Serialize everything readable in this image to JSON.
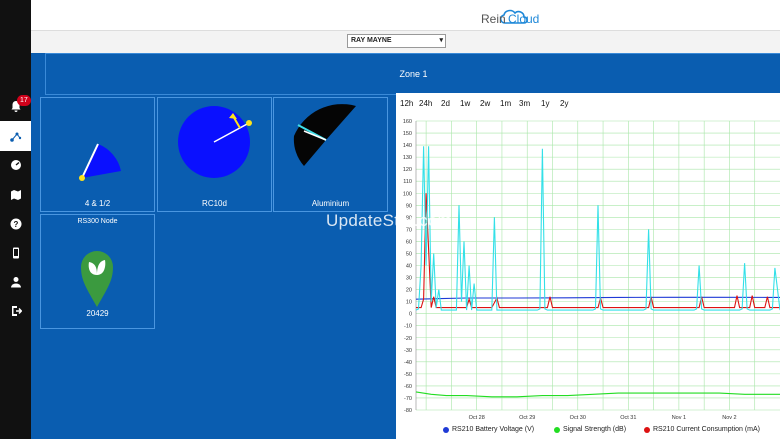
{
  "app": {
    "logo_text_a": "Rein",
    "logo_text_b": "Cloud"
  },
  "selector": {
    "selected": "RAY MAYNE"
  },
  "zone": {
    "title": "Zone 1"
  },
  "sidebar": {
    "notification_count": "17",
    "items": [
      "bell-icon",
      "sprinkler-icon",
      "gauge-icon",
      "map-icon",
      "help-icon",
      "phone-icon",
      "user-icon",
      "logout-icon"
    ]
  },
  "tiles": [
    {
      "label": "4 & 1/2"
    },
    {
      "label": "RC10d"
    },
    {
      "label": "Aluminium"
    },
    {
      "title": "RS300 Node",
      "label": "20429"
    }
  ],
  "watermark": "UpdateStar.com",
  "chart_panel": {
    "ranges": [
      "12h",
      "24h",
      "2d",
      "1w",
      "2w",
      "1m",
      "3m",
      "1y",
      "2y"
    ]
  },
  "chart_data": {
    "type": "line",
    "ylim": [
      -80,
      160
    ],
    "yticks": [
      160,
      150,
      140,
      130,
      120,
      110,
      100,
      90,
      80,
      70,
      60,
      50,
      40,
      30,
      20,
      10,
      0,
      -10,
      -20,
      -30,
      -40,
      -50,
      -60,
      -70,
      -80
    ],
    "x_ticks": [
      "Oct 28",
      "Oct 29",
      "Oct 30",
      "Oct 31",
      "Nov 1",
      "Nov 2"
    ],
    "grid": true,
    "legend_position": "bottom",
    "series": [
      {
        "name": "RS210 Battery Voltage (V)",
        "color": "#1f3ad6",
        "x": [
          0,
          0.5,
          1,
          2,
          3,
          4,
          5,
          6,
          7,
          7.2
        ],
        "y": [
          12,
          12.5,
          13,
          13,
          13.2,
          13.5,
          13.6,
          13.6,
          13.5,
          13.5
        ]
      },
      {
        "name": "Signal Strength (dB)",
        "color": "#22dd22",
        "x": [
          0,
          0.3,
          0.6,
          1,
          1.5,
          2,
          2.5,
          3,
          3.5,
          4,
          4.5,
          5,
          5.5,
          6,
          6.5,
          7,
          7.2
        ],
        "y": [
          -65,
          -67,
          -68,
          -68,
          -69,
          -69,
          -68,
          -68,
          -67,
          -66,
          -66,
          -66,
          -66,
          -66,
          -67,
          -67,
          -67
        ]
      },
      {
        "name": "RS210 Current Consumption (mA)",
        "color": "#dd1111",
        "x": [
          0,
          0.1,
          0.15,
          0.2,
          0.3,
          0.35,
          0.4,
          0.5,
          0.8,
          1.0,
          1.05,
          1.1,
          1.5,
          1.6,
          1.65,
          1.7,
          2.6,
          2.65,
          2.7,
          3.6,
          3.65,
          3.7,
          4.6,
          4.65,
          4.7,
          5.6,
          5.65,
          5.7,
          6.3,
          6.35,
          6.4,
          6.6,
          6.65,
          6.7,
          6.9,
          6.95,
          7.0,
          7.2
        ],
        "y": [
          5,
          5,
          12,
          100,
          5,
          14,
          5,
          5,
          5,
          5,
          12,
          5,
          5,
          13,
          5,
          5,
          5,
          14,
          5,
          5,
          13,
          5,
          5,
          14,
          5,
          5,
          14,
          5,
          5,
          15,
          5,
          5,
          15,
          5,
          5,
          14,
          5,
          5
        ]
      },
      {
        "name": "",
        "color": "#33e0e8",
        "x": [
          0,
          0.05,
          0.1,
          0.15,
          0.2,
          0.25,
          0.3,
          0.35,
          0.4,
          0.45,
          0.5,
          0.6,
          0.7,
          0.8,
          0.85,
          0.9,
          0.95,
          1.0,
          1.05,
          1.1,
          1.15,
          1.2,
          1.4,
          1.5,
          1.55,
          1.6,
          2.4,
          2.45,
          2.5,
          2.55,
          2.6,
          2.8,
          3.0,
          3.5,
          3.55,
          3.6,
          3.65,
          3.7,
          4.5,
          4.55,
          4.6,
          4.65,
          4.7,
          5.5,
          5.55,
          5.6,
          5.65,
          5.7,
          6.4,
          6.45,
          6.5,
          6.55,
          6.6,
          7.0,
          7.05,
          7.1,
          7.2
        ],
        "y": [
          3,
          4,
          40,
          139,
          40,
          139,
          10,
          50,
          5,
          20,
          3,
          3,
          3,
          3,
          90,
          10,
          60,
          3,
          40,
          3,
          25,
          3,
          3,
          3,
          80,
          3,
          3,
          4,
          137,
          4,
          3,
          3,
          3,
          3,
          4,
          90,
          4,
          3,
          3,
          4,
          70,
          4,
          3,
          3,
          4,
          40,
          4,
          3,
          3,
          4,
          42,
          4,
          3,
          3,
          4,
          38,
          3
        ]
      }
    ]
  }
}
